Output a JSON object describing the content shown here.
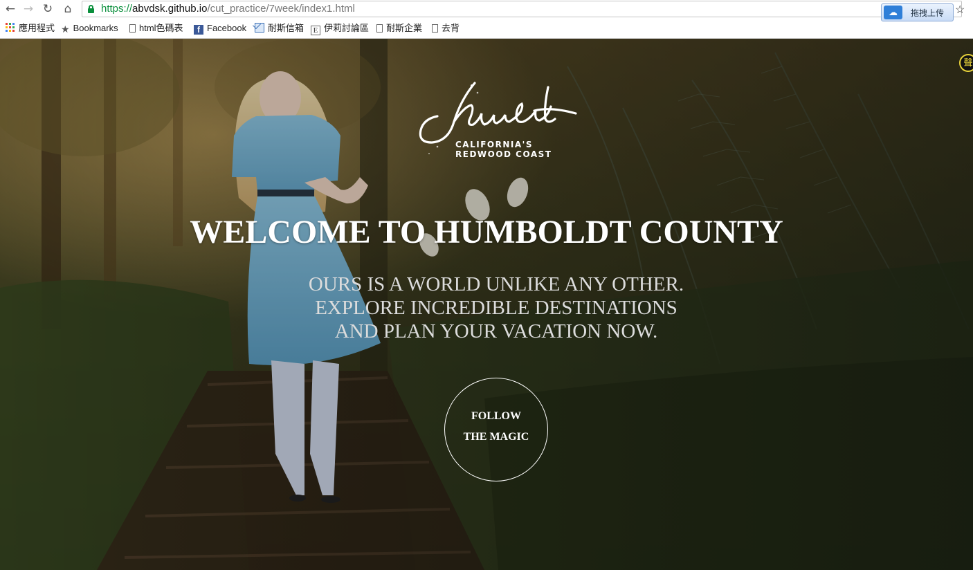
{
  "browser": {
    "url_scheme": "https://",
    "url_host": "abvdsk.github.io",
    "url_path": "/cut_practice/7week/index1.html",
    "extension_button_label": "拖拽上传",
    "icons": {
      "back": "back-arrow-icon",
      "forward": "forward-arrow-icon",
      "reload": "reload-icon",
      "home": "home-icon",
      "secure": "lock-icon",
      "bookmark_star": "star-icon"
    }
  },
  "bookmarks": [
    {
      "label": "應用程式",
      "icon": "apps-grid-icon"
    },
    {
      "label": "Bookmarks",
      "icon": "star-icon"
    },
    {
      "label": "html色碼表",
      "icon": "page-icon"
    },
    {
      "label": "Facebook",
      "icon": "facebook-icon"
    },
    {
      "label": "耐斯信箱",
      "icon": "mail-icon"
    },
    {
      "label": "伊莉討論區",
      "icon": "e-site-icon"
    },
    {
      "label": "耐斯企業",
      "icon": "page-icon"
    },
    {
      "label": "去背",
      "icon": "page-icon"
    }
  ],
  "hero": {
    "logo_script": "Humboldt",
    "logo_tagline_1": "CALIFORNIA'S",
    "logo_tagline_2": "REDWOOD COAST",
    "headline": "WELCOME TO HUMBOLDT COUNTY",
    "tagline_lines": [
      "OURS IS A WORLD UNLIKE ANY OTHER.",
      "EXPLORE INCREDIBLE DESTINATIONS",
      "AND PLAN YOUR VACATION NOW."
    ],
    "cta_line_1": "FOLLOW",
    "cta_line_2": "THE MAGIC",
    "side_badge": "聲"
  },
  "colors": {
    "secure_green": "#0a8f3c",
    "headline_text": "#ffffff",
    "tagline_text": "#dcdcdc"
  }
}
